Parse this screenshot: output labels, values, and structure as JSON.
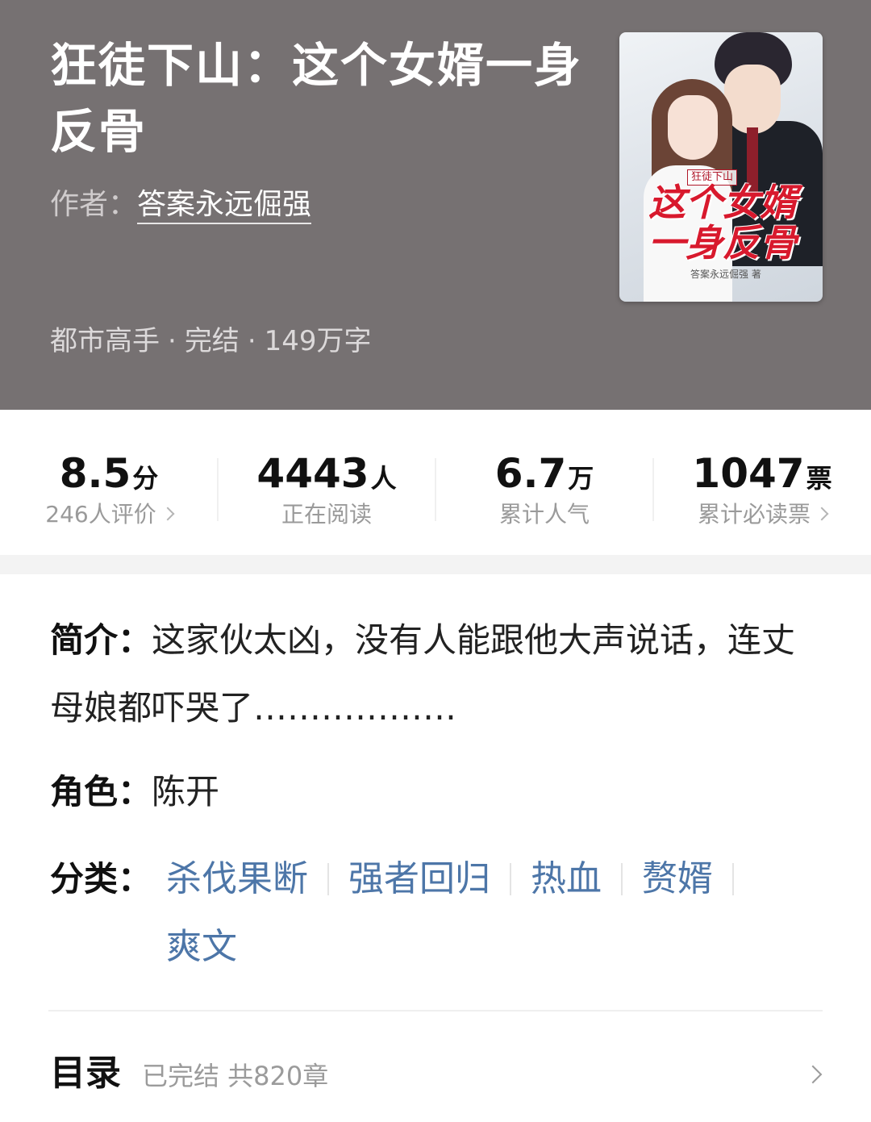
{
  "book": {
    "title": "狂徒下山：这个女婿一身反骨",
    "author_prefix": "作者：",
    "author": "答案永远倔强",
    "genre": "都市高手",
    "status": "完结",
    "word_count": "149万字",
    "cover": {
      "tag": "狂徒下山",
      "title": "这个女婿一身反骨",
      "author": "答案永远倔强 著"
    }
  },
  "stats": [
    {
      "value": "8.5",
      "unit": "分",
      "label": "246人评价"
    },
    {
      "value": "4443",
      "unit": "人",
      "label": "正在阅读"
    },
    {
      "value": "6.7",
      "unit": "万",
      "label": "累计人气"
    },
    {
      "value": "1047",
      "unit": "票",
      "label": "累计必读票"
    }
  ],
  "details": {
    "intro_key": "简介：",
    "intro_value": "这家伙太凶，没有人能跟他大声说话，连丈母娘都吓哭了………………",
    "role_key": "角色：",
    "role_value": "陈开",
    "category_key": "分类：",
    "categories": [
      "杀伐果断",
      "强者回归",
      "热血",
      "赘婿",
      "爽文"
    ]
  },
  "toc": {
    "title": "目录",
    "status": "已完结 共820章"
  },
  "colors": {
    "header_bg": "#767172",
    "tag_link": "#4d76a8",
    "cover_title": "#d8192d"
  }
}
